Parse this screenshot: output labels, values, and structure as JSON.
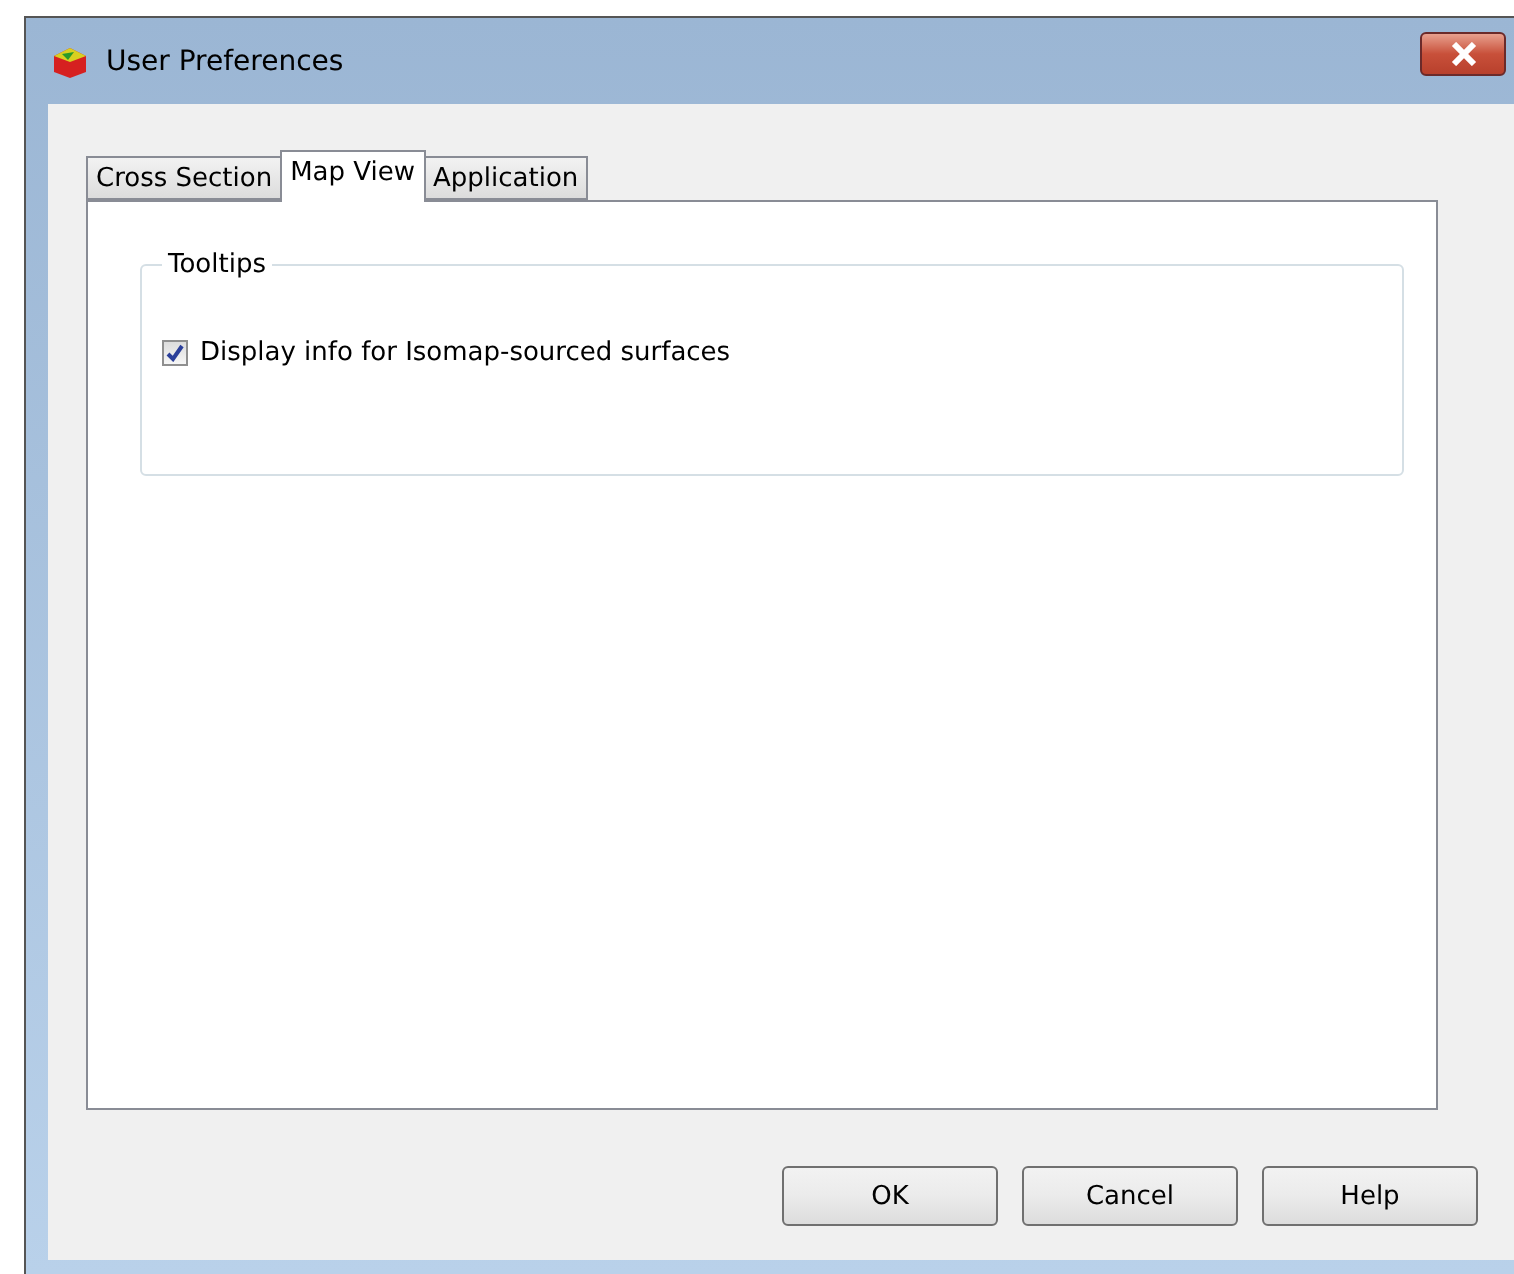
{
  "window": {
    "title": "User Preferences"
  },
  "tabs": [
    {
      "label": "Cross Section",
      "selected": false
    },
    {
      "label": "Map View",
      "selected": true
    },
    {
      "label": "Application",
      "selected": false
    }
  ],
  "group": {
    "title": "Tooltips",
    "options": [
      {
        "label": "Display info for Isomap-sourced surfaces",
        "checked": true
      }
    ]
  },
  "buttons": [
    "OK",
    "Cancel",
    "Help"
  ]
}
